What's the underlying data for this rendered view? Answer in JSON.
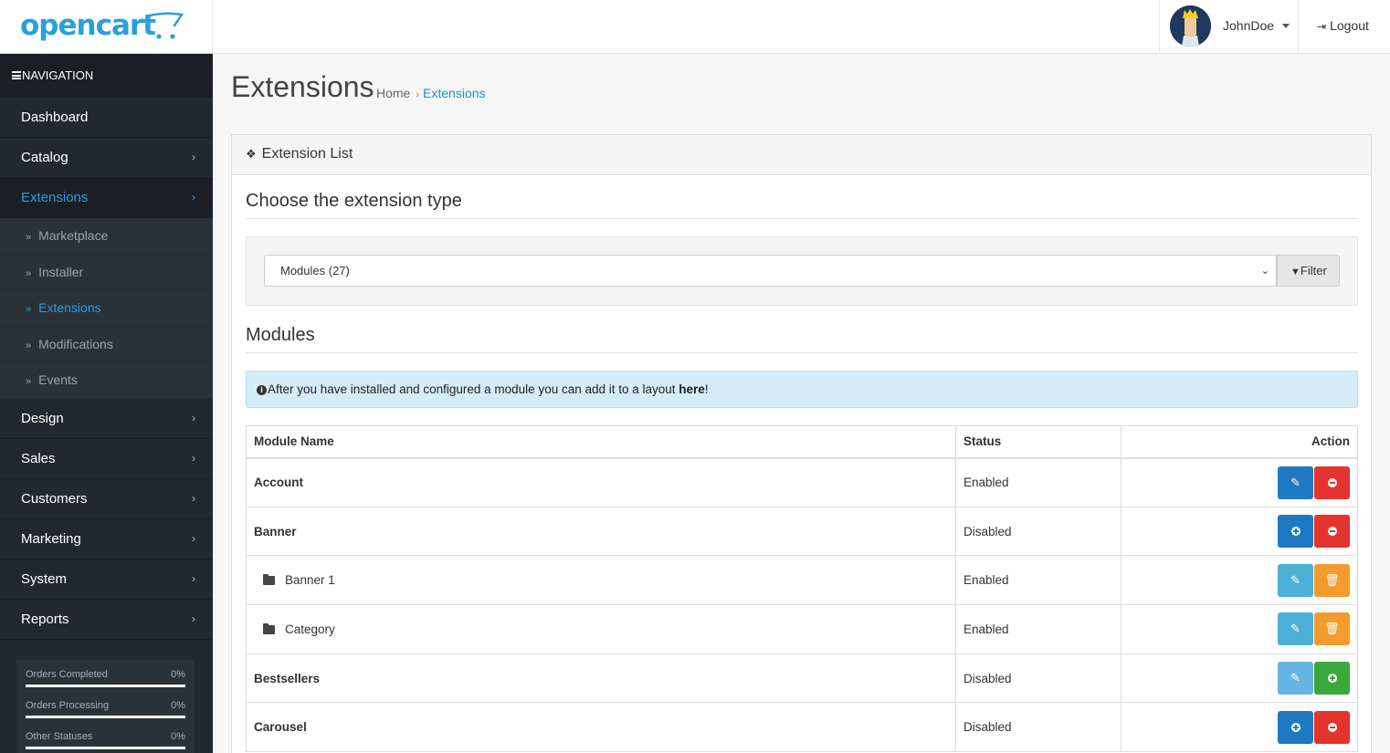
{
  "brand": {
    "name": "opencart"
  },
  "header": {
    "username": "JohnDoe",
    "logout_label": "Logout"
  },
  "sidebar": {
    "nav_title": "NAVIGATION",
    "items": [
      {
        "label": "Dashboard"
      },
      {
        "label": "Catalog"
      },
      {
        "label": "Extensions"
      },
      {
        "label": "Design"
      },
      {
        "label": "Sales"
      },
      {
        "label": "Customers"
      },
      {
        "label": "Marketing"
      },
      {
        "label": "System"
      },
      {
        "label": "Reports"
      }
    ],
    "subitems": [
      {
        "label": "Marketplace"
      },
      {
        "label": "Installer"
      },
      {
        "label": "Extensions"
      },
      {
        "label": "Modifications"
      },
      {
        "label": "Events"
      }
    ],
    "stats": [
      {
        "label": "Orders Completed",
        "value": "0%"
      },
      {
        "label": "Orders Processing",
        "value": "0%"
      },
      {
        "label": "Other Statuses",
        "value": "0%"
      }
    ]
  },
  "page": {
    "title": "Extensions",
    "breadcrumb": [
      "Home",
      "Extensions"
    ],
    "panel_title": "Extension List",
    "choose_heading": "Choose the extension type",
    "select_value": "Modules (27)",
    "filter_label": "Filter",
    "section_heading": "Modules",
    "alert": {
      "text": "After you have installed and configured a module you can add it to a layout ",
      "link": "here",
      "suffix": "!"
    }
  },
  "table": {
    "headers": [
      "Module Name",
      "Status",
      "Action"
    ],
    "rows": [
      {
        "name": "Account",
        "status": "Enabled"
      },
      {
        "name": "Banner",
        "status": "Disabled"
      },
      {
        "name": "Banner 1",
        "status": "Enabled"
      },
      {
        "name": "Category",
        "status": "Enabled"
      },
      {
        "name": "Bestsellers",
        "status": "Disabled"
      },
      {
        "name": "Carousel",
        "status": "Disabled"
      }
    ]
  },
  "colors": {
    "accent": "#1e91cf",
    "sidebar_bg": "#23282e",
    "danger": "#e3342f",
    "warning": "#f49b2e",
    "success": "#3aa83c"
  }
}
